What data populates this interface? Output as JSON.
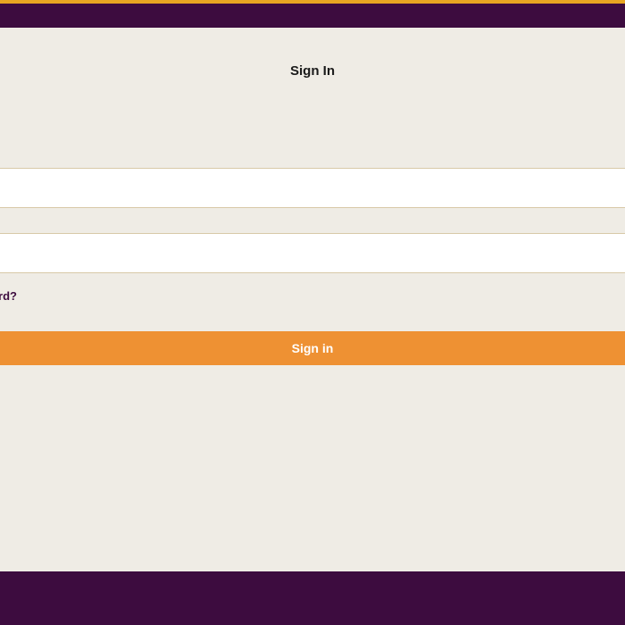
{
  "colors": {
    "gold": "#e8a622",
    "purple": "#3d0c3f",
    "orange": "#ee9133",
    "background": "#efece5",
    "inputBorder": "#d8c9a8"
  },
  "page": {
    "title": "Sign In"
  },
  "form": {
    "username": {
      "value": "",
      "placeholder": ""
    },
    "password": {
      "value": "",
      "placeholder": ""
    },
    "forgotLink": "word?",
    "submitLabel": "Sign in"
  }
}
